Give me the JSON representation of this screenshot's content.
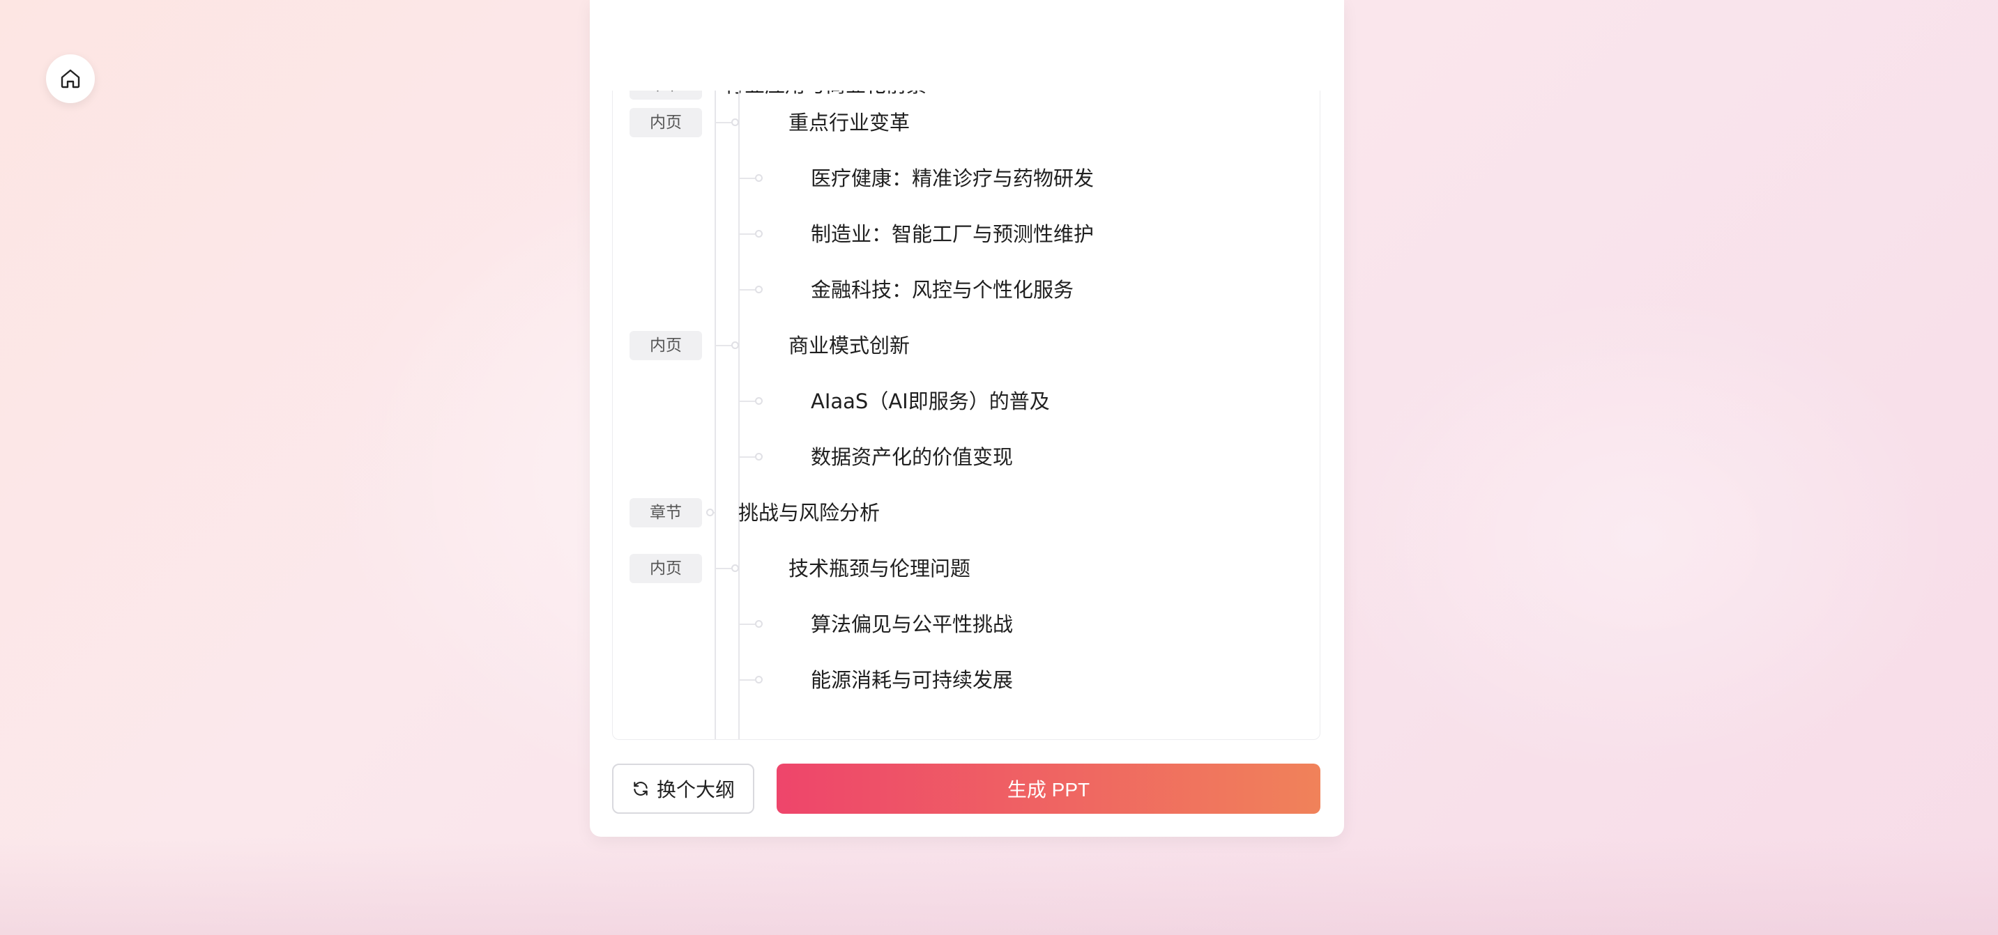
{
  "nav": {
    "home_icon": "home-icon"
  },
  "outline": {
    "partial_top": {
      "tag": "章节",
      "text": "行业应用与商业化前景"
    },
    "rows": [
      {
        "tag": "内页",
        "text": "重点行业变革",
        "level": 2
      },
      {
        "tag": "",
        "text": "医疗健康：精准诊疗与药物研发",
        "level": 3
      },
      {
        "tag": "",
        "text": "制造业：智能工厂与预测性维护",
        "level": 3
      },
      {
        "tag": "",
        "text": "金融科技：风控与个性化服务",
        "level": 3
      },
      {
        "tag": "内页",
        "text": "商业模式创新",
        "level": 2
      },
      {
        "tag": "",
        "text": "AIaaS（AI即服务）的普及",
        "level": 3
      },
      {
        "tag": "",
        "text": "数据资产化的价值变现",
        "level": 3
      },
      {
        "tag": "章节",
        "text": "挑战与风险分析",
        "level": 1
      },
      {
        "tag": "内页",
        "text": "技术瓶颈与伦理问题",
        "level": 2
      },
      {
        "tag": "",
        "text": "算法偏见与公平性挑战",
        "level": 3
      },
      {
        "tag": "",
        "text": "能源消耗与可持续发展",
        "level": 3
      }
    ]
  },
  "actions": {
    "regen_label": "换个大纲",
    "regen_icon": "refresh-icon",
    "generate_label": "生成 PPT"
  },
  "colors": {
    "primary_start": "#ee456b",
    "primary_end": "#f0825a"
  }
}
